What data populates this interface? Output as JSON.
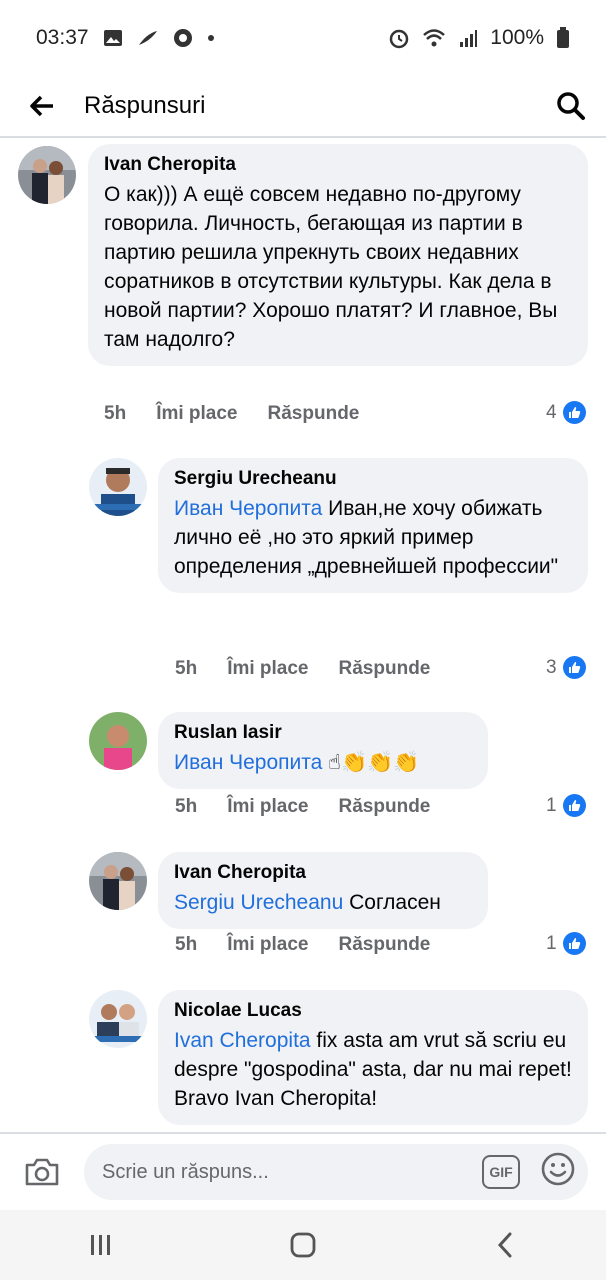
{
  "status_bar": {
    "time": "03:37",
    "battery": "100%"
  },
  "header": {
    "title": "Răspunsuri"
  },
  "action_labels": {
    "like": "Îmi place",
    "reply": "Răspunde"
  },
  "comments": [
    {
      "name": "Ivan  Cheropita",
      "text": "О как))) А ещё совсем недавно по-другому говорила. Личность, бегающая из партии в партию решила упрекнуть своих недавних соратников в отсутствии культуры. Как дела в новой партии? Хорошо платят? И главное, Вы там надолго?",
      "time": "5h",
      "likes": "4"
    },
    {
      "name": "Sergiu Urecheanu",
      "mention": "Иван Черопита",
      "text": " Иван,не хочу обижать лично её ,но это яркий пример",
      "text2": "определения  „древнейшей профессии\"",
      "time": "5h",
      "likes": "3"
    },
    {
      "name": "Ruslan Iasir",
      "mention": "Иван Черопита",
      "text": " ☝👏👏👏",
      "time": "5h",
      "likes": "1"
    },
    {
      "name": "Ivan  Cheropita",
      "mention": "Sergiu Urecheanu",
      "text": " Согласен",
      "time": "5h",
      "likes": "1"
    },
    {
      "name": "Nicolae Lucas",
      "mention": "Ivan  Cheropita",
      "text": " fix asta am vrut să scriu eu despre \"gospodina\" asta, dar nu mai repet! Bravo Ivan Cheropita!"
    }
  ],
  "composer": {
    "placeholder": "Scrie un răspuns...",
    "gif_label": "GIF"
  },
  "colors": {
    "mention": "#216fdb",
    "like_blue": "#1877f2",
    "bubble": "#f0f2f5",
    "meta_gray": "#65676b"
  }
}
